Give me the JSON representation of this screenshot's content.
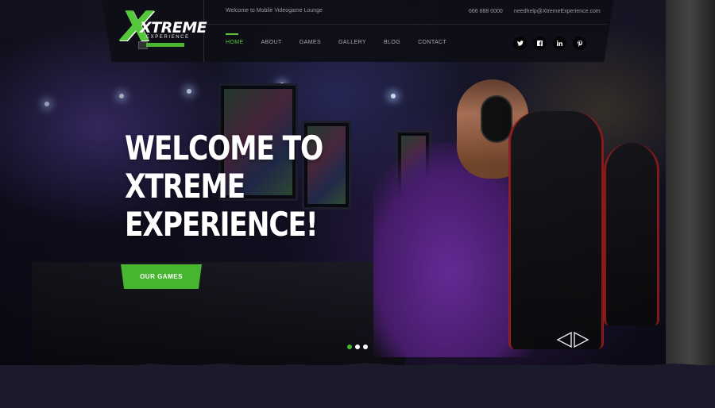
{
  "header": {
    "logo_text": "XTREME",
    "logo_subtext": "EXPERIENCE",
    "tagline": "Welcome to Mobile Videogame Lounge",
    "phone": "666 888 0000",
    "email": "needhelp@XtremeExperience.com",
    "nav": [
      "HOME",
      "ABOUT",
      "GAMES",
      "GALLERY",
      "BLOG",
      "CONTACT"
    ],
    "social": [
      "twitter-icon",
      "facebook-icon",
      "linkedin-icon",
      "pinterest-icon"
    ]
  },
  "hero": {
    "headline_lines": [
      "WELCOME TO",
      "XTREME",
      "EXPERIENCE!"
    ],
    "cta_label": "OUR GAMES",
    "slides_total": 3,
    "active_slide": 1
  },
  "colors": {
    "accent": "#46b52f",
    "header_bg": "#0e0e16",
    "page_bg": "#1a1a2b"
  }
}
